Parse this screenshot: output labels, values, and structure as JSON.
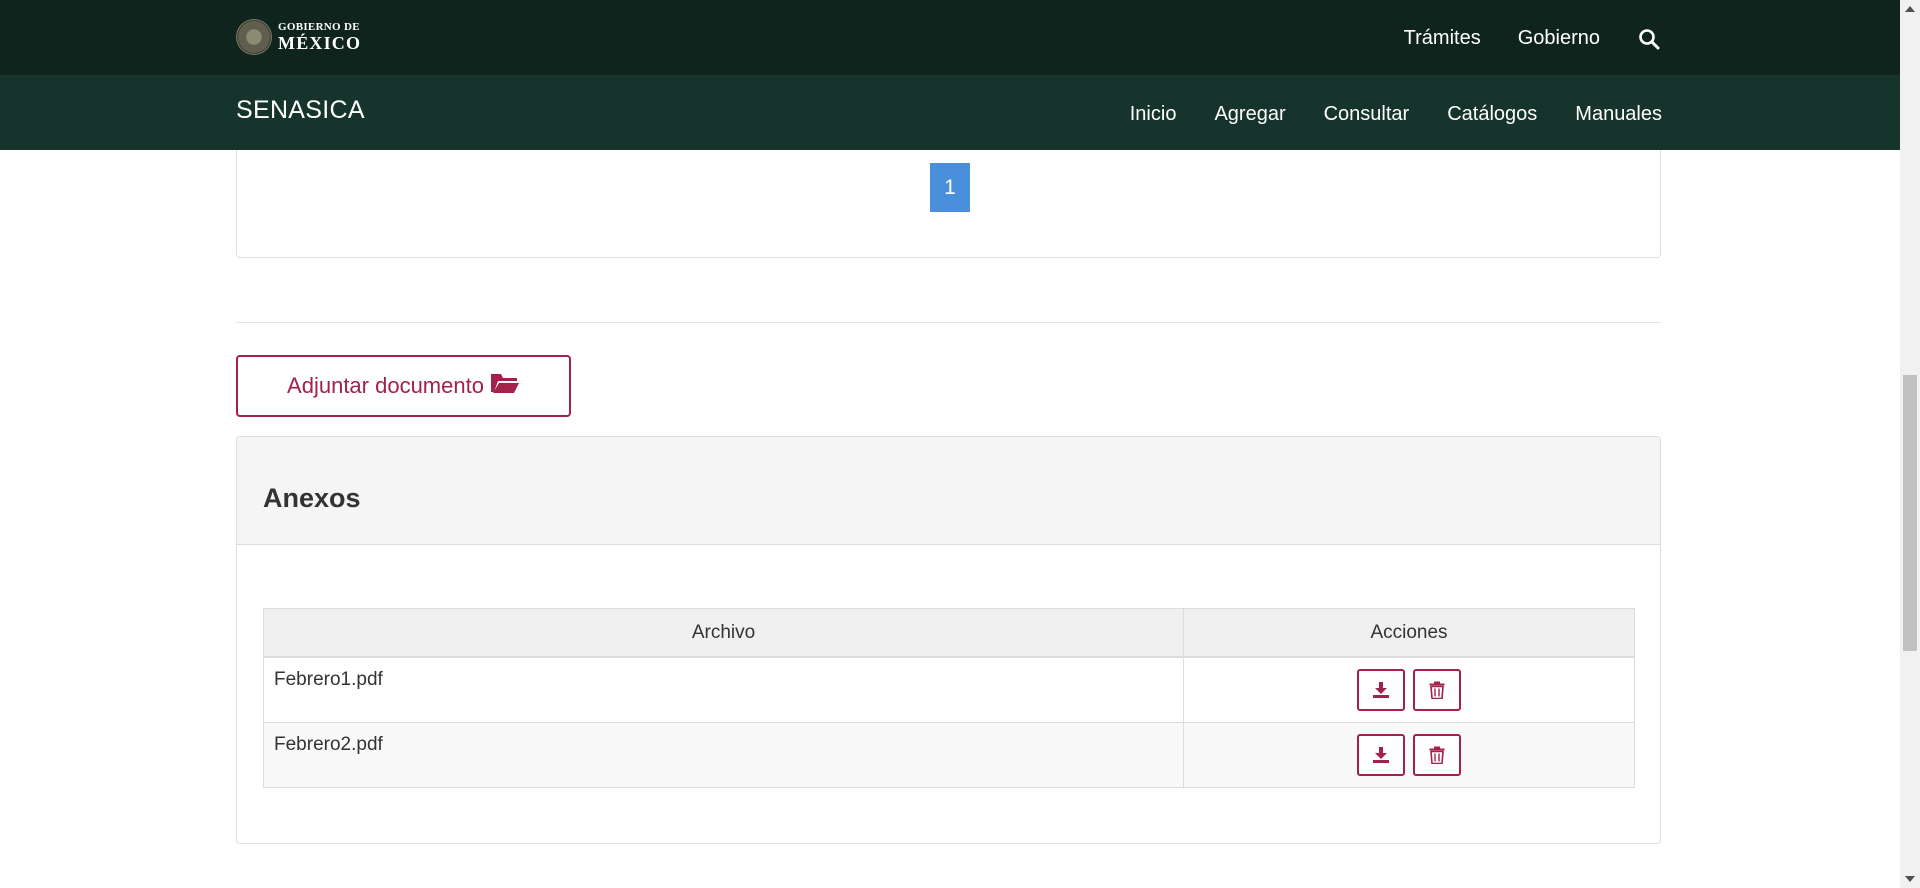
{
  "gov_header": {
    "logo_small": "GOBIERNO DE",
    "logo_big": "MÉXICO",
    "links": [
      "Trámites",
      "Gobierno"
    ],
    "search_icon": "search-icon"
  },
  "main_header": {
    "brand": "SENASICA",
    "nav": [
      "Inicio",
      "Agregar",
      "Consultar",
      "Catálogos",
      "Manuales"
    ]
  },
  "pagination": {
    "current_page": "1"
  },
  "attach": {
    "label": "Adjuntar documento",
    "icon": "folder-open-icon"
  },
  "anexos": {
    "title": "Anexos",
    "columns": [
      "Archivo",
      "Acciones"
    ],
    "rows": [
      {
        "file": "Febrero1.pdf",
        "actions": [
          "download-icon",
          "trash-icon"
        ]
      },
      {
        "file": "Febrero2.pdf",
        "actions": [
          "download-icon",
          "trash-icon"
        ]
      }
    ]
  },
  "colors": {
    "gov_bar": "#10241e",
    "main_bar": "#16342c",
    "accent": "#a3214a",
    "page_active": "#4a8fdc"
  }
}
